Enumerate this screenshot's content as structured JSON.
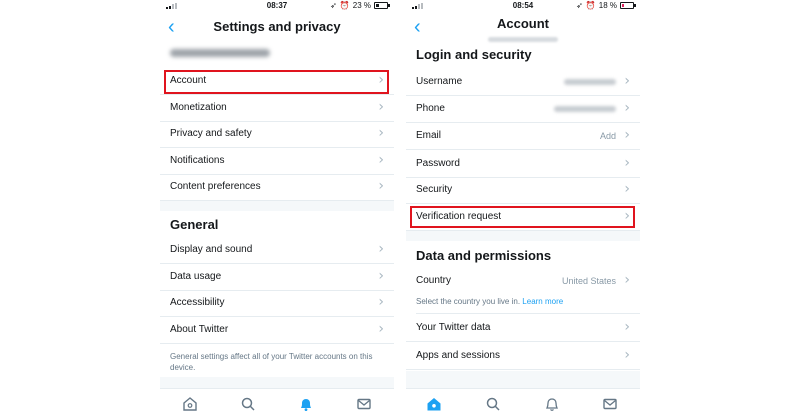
{
  "colors": {
    "accent": "#1da1f2",
    "highlight": "#e0141e",
    "text": "#14171a",
    "muted": "#8899a6",
    "separator": "#e6ecf0"
  },
  "screen1": {
    "status": {
      "time": "08:37",
      "battery": "23 %",
      "battery_level": 0.23
    },
    "nav": {
      "title": "Settings and privacy",
      "back_icon": "back-chevron-icon"
    },
    "account_rows": [
      {
        "label": "Account"
      },
      {
        "label": "Monetization"
      },
      {
        "label": "Privacy and safety"
      },
      {
        "label": "Notifications"
      },
      {
        "label": "Content preferences"
      }
    ],
    "general": {
      "title": "General",
      "rows": [
        {
          "label": "Display and sound"
        },
        {
          "label": "Data usage"
        },
        {
          "label": "Accessibility"
        },
        {
          "label": "About Twitter"
        }
      ],
      "note": "General settings affect all of your Twitter accounts on this device."
    },
    "tabs": [
      "home-icon",
      "search-icon",
      "notifications-bell-icon",
      "messages-icon"
    ],
    "active_tab": 2
  },
  "screen2": {
    "status": {
      "time": "08:54",
      "battery": "18 %",
      "battery_level": 0.18
    },
    "nav": {
      "title": "Account",
      "back_icon": "back-chevron-icon"
    },
    "login": {
      "title": "Login and security",
      "rows": [
        {
          "label": "Username"
        },
        {
          "label": "Phone"
        },
        {
          "label": "Email",
          "value": "Add"
        },
        {
          "label": "Password"
        },
        {
          "label": "Security"
        },
        {
          "label": "Verification request"
        }
      ]
    },
    "data": {
      "title": "Data and permissions",
      "country": {
        "label": "Country",
        "value": "United States"
      },
      "note": "Select the country you live in.",
      "note_link": "Learn more",
      "rows": [
        {
          "label": "Your Twitter data"
        },
        {
          "label": "Apps and sessions"
        }
      ]
    },
    "tabs": [
      "home-icon",
      "search-icon",
      "notifications-bell-icon",
      "messages-icon"
    ],
    "active_tab": 0
  }
}
